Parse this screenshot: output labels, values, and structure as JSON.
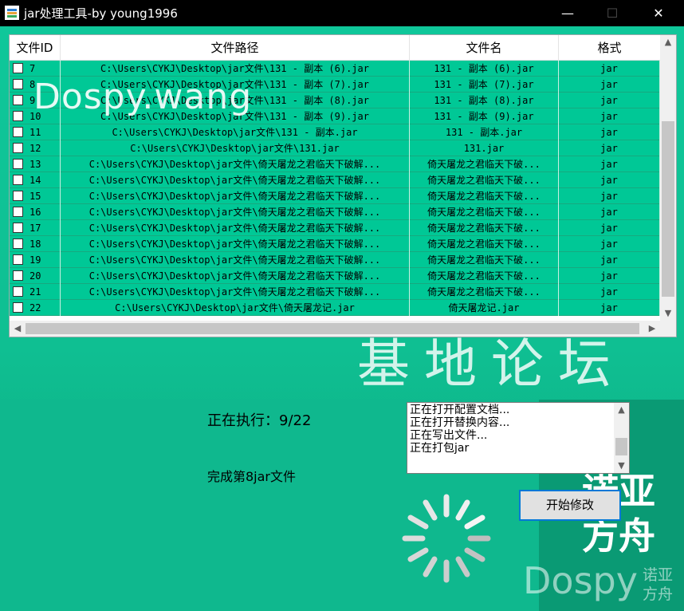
{
  "window": {
    "title": "jar处理工具-by young1996",
    "minimize_glyph": "—",
    "maximize_glyph": "☐",
    "close_glyph": "✕"
  },
  "table": {
    "columns": [
      "文件ID",
      "文件路径",
      "文件名",
      "格式"
    ],
    "rows": [
      {
        "id": "7",
        "path": "C:\\Users\\CYKJ\\Desktop\\jar文件\\131 - 副本 (6).jar",
        "name": "131 - 副本 (6).jar",
        "format": "jar"
      },
      {
        "id": "8",
        "path": "C:\\Users\\CYKJ\\Desktop\\jar文件\\131 - 副本 (7).jar",
        "name": "131 - 副本 (7).jar",
        "format": "jar"
      },
      {
        "id": "9",
        "path": "C:\\Users\\CYKJ\\Desktop\\jar文件\\131 - 副本 (8).jar",
        "name": "131 - 副本 (8).jar",
        "format": "jar"
      },
      {
        "id": "10",
        "path": "C:\\Users\\CYKJ\\Desktop\\jar文件\\131 - 副本 (9).jar",
        "name": "131 - 副本 (9).jar",
        "format": "jar"
      },
      {
        "id": "11",
        "path": "C:\\Users\\CYKJ\\Desktop\\jar文件\\131 - 副本.jar",
        "name": "131 - 副本.jar",
        "format": "jar"
      },
      {
        "id": "12",
        "path": "C:\\Users\\CYKJ\\Desktop\\jar文件\\131.jar",
        "name": "131.jar",
        "format": "jar"
      },
      {
        "id": "13",
        "path": "C:\\Users\\CYKJ\\Desktop\\jar文件\\倚天屠龙之君临天下破解...",
        "name": "倚天屠龙之君临天下破...",
        "format": "jar"
      },
      {
        "id": "14",
        "path": "C:\\Users\\CYKJ\\Desktop\\jar文件\\倚天屠龙之君临天下破解...",
        "name": "倚天屠龙之君临天下破...",
        "format": "jar"
      },
      {
        "id": "15",
        "path": "C:\\Users\\CYKJ\\Desktop\\jar文件\\倚天屠龙之君临天下破解...",
        "name": "倚天屠龙之君临天下破...",
        "format": "jar"
      },
      {
        "id": "16",
        "path": "C:\\Users\\CYKJ\\Desktop\\jar文件\\倚天屠龙之君临天下破解...",
        "name": "倚天屠龙之君临天下破...",
        "format": "jar"
      },
      {
        "id": "17",
        "path": "C:\\Users\\CYKJ\\Desktop\\jar文件\\倚天屠龙之君临天下破解...",
        "name": "倚天屠龙之君临天下破...",
        "format": "jar"
      },
      {
        "id": "18",
        "path": "C:\\Users\\CYKJ\\Desktop\\jar文件\\倚天屠龙之君临天下破解...",
        "name": "倚天屠龙之君临天下破...",
        "format": "jar"
      },
      {
        "id": "19",
        "path": "C:\\Users\\CYKJ\\Desktop\\jar文件\\倚天屠龙之君临天下破解...",
        "name": "倚天屠龙之君临天下破...",
        "format": "jar"
      },
      {
        "id": "20",
        "path": "C:\\Users\\CYKJ\\Desktop\\jar文件\\倚天屠龙之君临天下破解...",
        "name": "倚天屠龙之君临天下破...",
        "format": "jar"
      },
      {
        "id": "21",
        "path": "C:\\Users\\CYKJ\\Desktop\\jar文件\\倚天屠龙之君临天下破解...",
        "name": "倚天屠龙之君临天下破...",
        "format": "jar"
      },
      {
        "id": "22",
        "path": "C:\\Users\\CYKJ\\Desktop\\jar文件\\倚天屠龙记.jar",
        "name": "倚天屠龙记.jar",
        "format": "jar"
      }
    ],
    "row_color": "#00c896"
  },
  "status": {
    "executing": "正在执行：9/22",
    "done": "完成第8jar文件"
  },
  "log": {
    "lines": [
      "正在打开配置文档...",
      "正在打开替换内容...",
      "正在写出文件...",
      "正在打包jar"
    ]
  },
  "start_button": "开始修改",
  "watermarks": {
    "dospy_wang": "Dospy.wang",
    "jidi": "基地论坛",
    "nuoya_big_1": "诺亚",
    "nuoya_big_2": "方舟",
    "dospy": "Dospy",
    "nuoya_small_1": "诺亚",
    "nuoya_small_2": "方舟"
  },
  "icons": {
    "app": "app-icon",
    "spinner": "loading-spinner-icon",
    "scroll_up": "▲",
    "scroll_down": "▼",
    "scroll_left": "◀",
    "scroll_right": "▶"
  }
}
